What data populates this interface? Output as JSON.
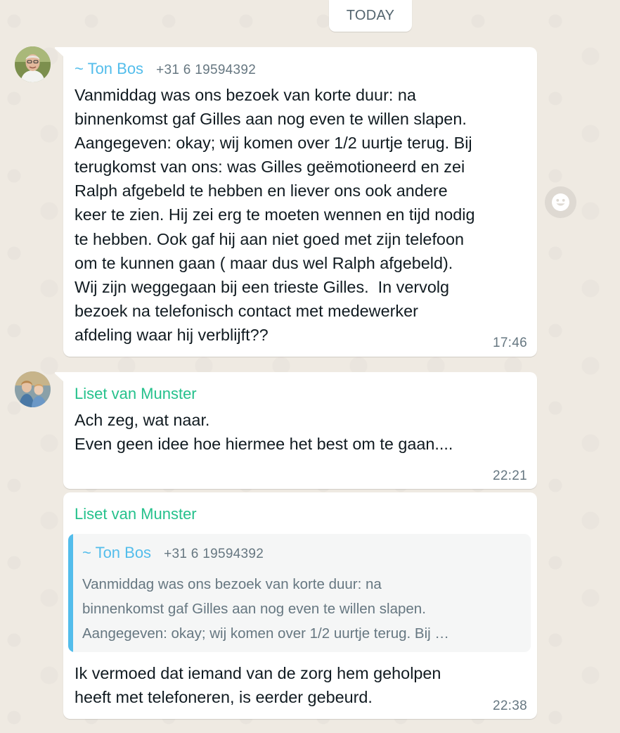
{
  "date_divider": "TODAY",
  "messages": [
    {
      "sender": "~ Ton Bos",
      "phone": "+31 6 19594392",
      "text": "Vanmiddag was ons bezoek van korte duur: na\nbinnenkomst gaf Gilles aan nog even te willen slapen.\nAangegeven: okay; wij komen over 1/2 uurtje terug. Bij\nterugkomst van ons: was Gilles geëmotioneerd en zei\nRalph afgebeld te hebben en liever ons ook andere\nkeer te zien. Hij zei erg te moeten wennen en tijd nodig\nte hebben. Ook gaf hij aan niet goed met zijn telefoon\nom te kunnen gaan ( maar dus wel Ralph afgebeld).\nWij zijn weggegaan bij een trieste Gilles.  In vervolg\nbezoek na telefonisch contact met medewerker\nafdeling waar hij verblijft??",
      "time": "17:46"
    },
    {
      "sender": "Liset van Munster",
      "text": "Ach zeg, wat naar.\nEven geen idee hoe hiermee het best om te gaan....",
      "time": "22:21"
    },
    {
      "sender": "Liset van Munster",
      "quote": {
        "sender": "~ Ton Bos",
        "phone": "+31 6 19594392",
        "text": "Vanmiddag was ons bezoek van korte duur: na\nbinnenkomst gaf Gilles aan nog even te willen slapen.\nAangegeven: okay; wij komen over 1/2 uurtje terug. Bij …"
      },
      "text": "Ik vermoed dat iemand van de zorg hem geholpen\nheeft met telefoneren, is eerder gebeurd.",
      "time": "22:38"
    }
  ],
  "colors": {
    "sender_blue": "#53bdeb",
    "sender_green": "#25c18c",
    "background": "#efeae2"
  },
  "icons": [
    "emoji-reaction-icon"
  ]
}
